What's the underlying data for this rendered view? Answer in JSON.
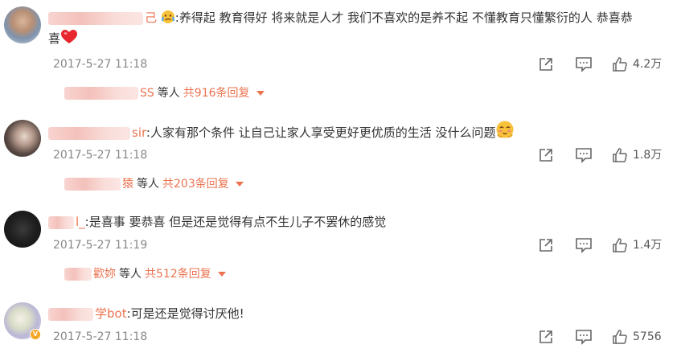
{
  "colors": {
    "accent": "#eb7350",
    "text": "#333333",
    "meta": "#888888",
    "icon": "#666666"
  },
  "comments": [
    {
      "username_visible": "己",
      "text": ":养得起 教育得好 将来就是人才 我们不喜欢的是养不起 不懂教育只懂繁衍的人 恭喜恭",
      "text_cont": "喜",
      "emoji_lead": "crying-emoji-icon",
      "emoji_trail": "heart-icon",
      "date": "2017-5-27 11:18",
      "likes": "4.2万",
      "reply": {
        "suffix": "SS",
        "others": "等人",
        "total": "共916条回复"
      }
    },
    {
      "username_visible": "sir",
      "text": ":人家有那个条件 让自己让家人享受更好更优质的生活 没什么问题",
      "emoji_trail": "blushing-emoji-icon",
      "date": "2017-5-27 11:18",
      "likes": "1.8万",
      "reply": {
        "suffix": "猿",
        "others": "等人",
        "total": "共203条回复"
      }
    },
    {
      "username_visible": "l_",
      "text": ":是喜事 要恭喜 但是还是觉得有点不生儿子不罢休的感觉",
      "date": "2017-5-27 11:19",
      "likes": "1.4万",
      "reply": {
        "suffix": "歡妳",
        "others": "等人",
        "total": "共512条回复"
      }
    },
    {
      "username_visible": "学bot",
      "text": ":可是还是觉得讨厌他!",
      "verified_badge": "V",
      "date": "2017-5-27 11:18",
      "likes": "5756"
    }
  ]
}
